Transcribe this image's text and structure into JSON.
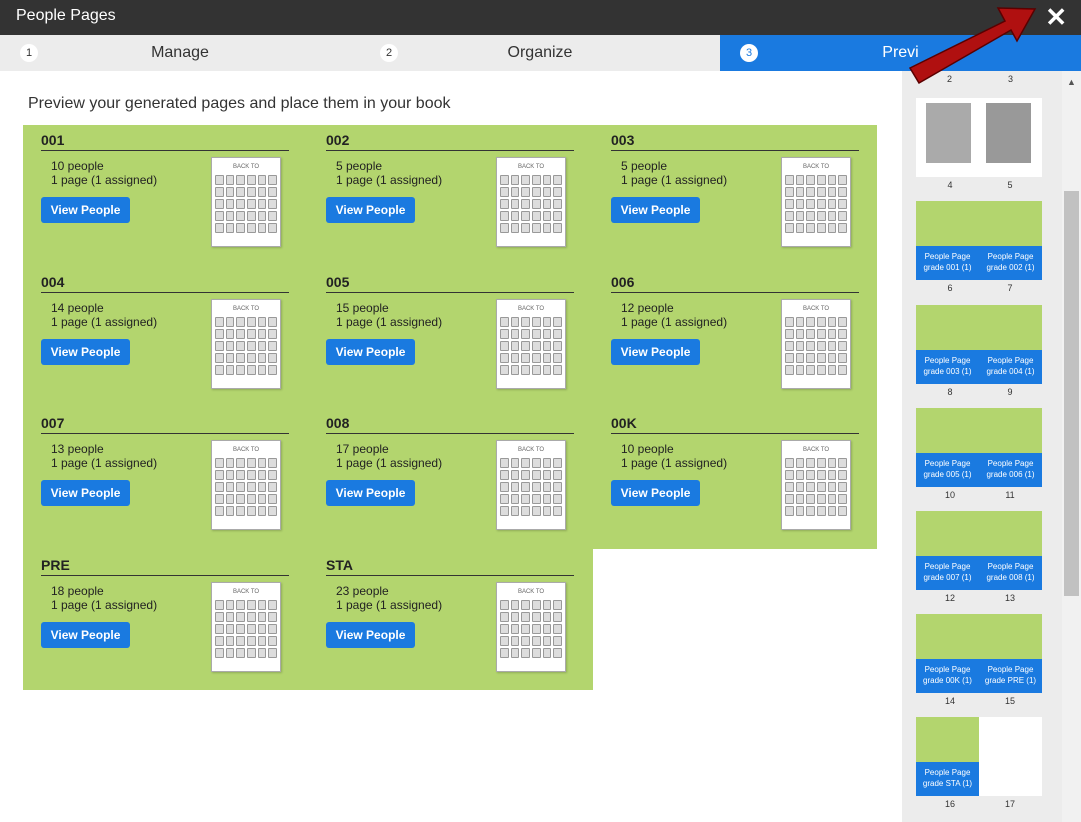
{
  "window": {
    "title": "People Pages"
  },
  "tabs": [
    {
      "num": "1",
      "label": "Manage"
    },
    {
      "num": "2",
      "label": "Organize"
    },
    {
      "num": "3",
      "label": "Previ"
    }
  ],
  "subtitle": "Preview your generated pages and place them in your book",
  "button_label": "View People",
  "cards": [
    {
      "name": "001",
      "people": "10 people",
      "pages": "1 page (1 assigned)"
    },
    {
      "name": "002",
      "people": "5 people",
      "pages": "1 page (1 assigned)"
    },
    {
      "name": "003",
      "people": "5 people",
      "pages": "1 page (1 assigned)"
    },
    {
      "name": "004",
      "people": "14 people",
      "pages": "1 page (1 assigned)"
    },
    {
      "name": "005",
      "people": "15 people",
      "pages": "1 page (1 assigned)"
    },
    {
      "name": "006",
      "people": "12 people",
      "pages": "1 page (1 assigned)"
    },
    {
      "name": "007",
      "people": "13 people",
      "pages": "1 page (1 assigned)"
    },
    {
      "name": "008",
      "people": "17 people",
      "pages": "1 page (1 assigned)"
    },
    {
      "name": "00K",
      "people": "10 people",
      "pages": "1 page (1 assigned)"
    },
    {
      "name": "PRE",
      "people": "18 people",
      "pages": "1 page (1 assigned)"
    },
    {
      "name": "STA",
      "people": "23 people",
      "pages": "1 page (1 assigned)"
    }
  ],
  "thumb_header": "BACK TO",
  "sidebar": {
    "top_numbers": [
      "2",
      "3"
    ],
    "photo_numbers": [
      "4",
      "5"
    ],
    "spreads": [
      {
        "left": [
          "People Page",
          "grade 001 (1)"
        ],
        "right": [
          "People Page",
          "grade 002 (1)"
        ],
        "nums": [
          "6",
          "7"
        ]
      },
      {
        "left": [
          "People Page",
          "grade 003 (1)"
        ],
        "right": [
          "People Page",
          "grade 004 (1)"
        ],
        "nums": [
          "8",
          "9"
        ]
      },
      {
        "left": [
          "People Page",
          "grade 005 (1)"
        ],
        "right": [
          "People Page",
          "grade 006 (1)"
        ],
        "nums": [
          "10",
          "11"
        ]
      },
      {
        "left": [
          "People Page",
          "grade 007 (1)"
        ],
        "right": [
          "People Page",
          "grade 008 (1)"
        ],
        "nums": [
          "12",
          "13"
        ]
      },
      {
        "left": [
          "People Page",
          "grade 00K (1)"
        ],
        "right": [
          "People Page",
          "grade PRE (1)"
        ],
        "nums": [
          "14",
          "15"
        ]
      },
      {
        "left": [
          "People Page",
          "grade STA (1)"
        ],
        "right": null,
        "nums": [
          "16",
          "17"
        ]
      }
    ]
  },
  "colors": {
    "accent": "#1a7ae0",
    "panel_green": "#b3d56e",
    "arrow_red": "#b01010"
  }
}
